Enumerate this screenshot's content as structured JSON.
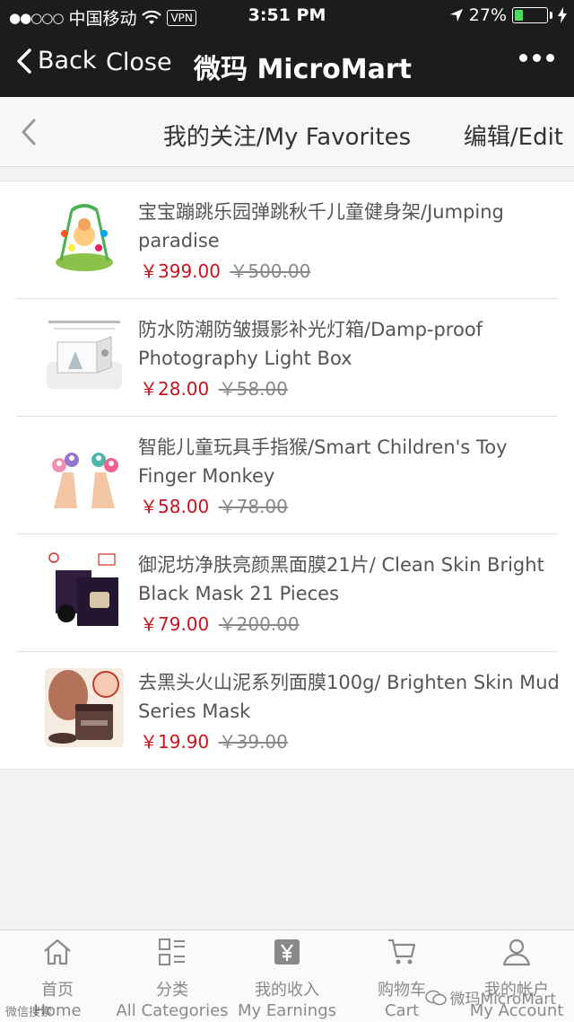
{
  "status_bar": {
    "signal_dots": "●●○○○",
    "carrier": "中国移动",
    "vpn": "VPN",
    "time": "3:51 PM",
    "battery_percent": "27%",
    "battery_level": 0.27
  },
  "wechat_nav": {
    "back_label": "Back",
    "close_label": "Close",
    "title": "微玛 MicroMart"
  },
  "page": {
    "title": "我的关注/My Favorites",
    "edit_label": "编辑/Edit"
  },
  "favorites": [
    {
      "name": "宝宝蹦跳乐园弹跳秋千儿童健身架/Jumping paradise",
      "price": "￥399.00",
      "original_price": "￥500.00",
      "thumb_icon": "baby-jumper-icon"
    },
    {
      "name": "防水防潮防皱摄影补光灯箱/Damp-proof Photography Light Box",
      "price": "￥28.00",
      "original_price": "￥58.00",
      "thumb_icon": "light-box-icon"
    },
    {
      "name": "智能儿童玩具手指猴/Smart Children's Toy Finger Monkey",
      "price": "￥58.00",
      "original_price": "￥78.00",
      "thumb_icon": "finger-monkey-icon"
    },
    {
      "name": "御泥坊净肤亮颜黑面膜21片/ Clean Skin Bright Black Mask 21 Pieces",
      "price": "￥79.00",
      "original_price": "￥200.00",
      "thumb_icon": "black-mask-icon"
    },
    {
      "name": "去黑头火山泥系列面膜100g/ Brighten Skin Mud Series Mask",
      "price": "￥19.90",
      "original_price": "￥39.00",
      "thumb_icon": "mud-mask-icon"
    }
  ],
  "tab_bar": [
    {
      "zh": "首页",
      "en": "Home",
      "icon": "home-icon"
    },
    {
      "zh": "分类",
      "en": "All Categories",
      "icon": "categories-icon"
    },
    {
      "zh": "我的收入",
      "en": "My Earnings",
      "icon": "yuan-icon"
    },
    {
      "zh": "购物车",
      "en": "Cart",
      "icon": "cart-icon"
    },
    {
      "zh": "我的帐户",
      "en": "My Account",
      "icon": "user-icon"
    }
  ],
  "watermark": {
    "left": "微信搜索",
    "right": "微玛MicroMart"
  }
}
